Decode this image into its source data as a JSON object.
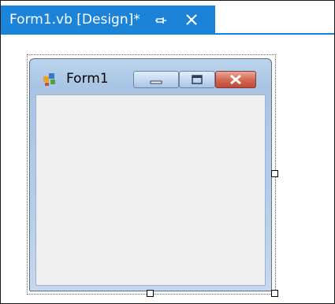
{
  "tab": {
    "title": "Form1.vb [Design]*",
    "pin_icon": "pin-icon",
    "close_icon": "close-icon",
    "color": "#1b84d9"
  },
  "form": {
    "title": "Form1",
    "icon": "form-app-icon",
    "minimize_icon": "minimize-icon",
    "maximize_icon": "maximize-icon",
    "close_icon": "close-icon",
    "client_color": "#efefef"
  }
}
